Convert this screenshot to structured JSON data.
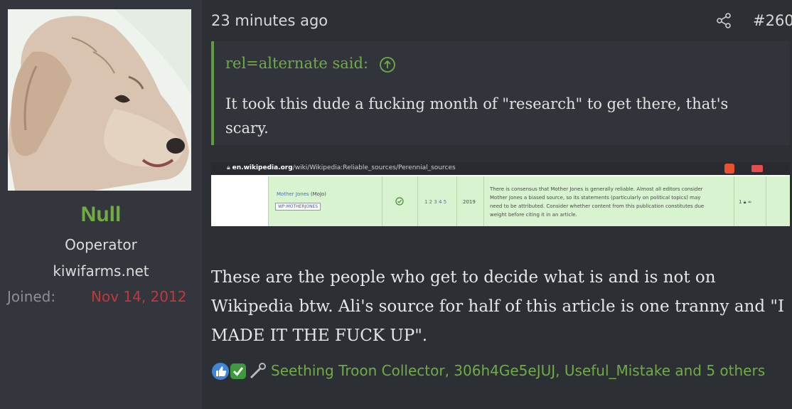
{
  "user": {
    "name": "Null",
    "title": "Ooperator",
    "banner": "kiwifarms.net",
    "joined_label": "Joined:",
    "joined_date": "Nov 14, 2012"
  },
  "post": {
    "time": "23 minutes ago",
    "number": "#260",
    "quote": {
      "attribution": "rel=alternate said:",
      "text": "It took this dude a fucking month of \"research\" to get there, that's scary."
    },
    "screenshot": {
      "url_host": "en.wikipedia.org",
      "url_path": "/wiki/Wikipedia:Reliable_sources/Perennial_sources",
      "source_name": "Mother Jones",
      "source_abbr": "(MoJo)",
      "shortcut": "WP:MOTHERJONES",
      "discussions": "1 2 3 4 5",
      "year": "2019",
      "summary_line1": "There is consensus that Mother Jones is generally reliable. Almost all editors consider",
      "summary_line2": "Mother Jones a biased source, so its statements (particularly on political topics) may",
      "summary_line3": "need to be attributed. Consider whether content from this publication constitutes due",
      "summary_line4": "weight before citing it in an article.",
      "uses": "1"
    },
    "body": "These are the people who get to decide what is and is not on Wikipedia btw. Ali's source for half of this article is one tranny and \"I MADE IT THE FUCK UP\".",
    "reactions_text": "Seething Troon Collector, 306h4Ge5eJUJ, Useful_Mistake and 5 others"
  },
  "icons": {
    "share": "share-icon",
    "quote_expand": "arrow-up-circle-icon",
    "reactions": [
      "like-icon",
      "checkmark-icon",
      "wrench-icon"
    ]
  },
  "colors": {
    "accent_green": "#6fad43",
    "joined_red": "#c0393b",
    "background": "#2c2f34",
    "sidebar": "#33373d"
  }
}
